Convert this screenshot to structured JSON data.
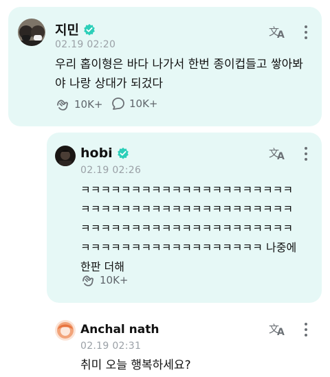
{
  "posts": [
    {
      "author": "지민",
      "time": "02.19 02:20",
      "text": "우리 홉이형은 바다 나가서 한번 종이컵들고 쌓아봐야 나랑 상대가 되겄다",
      "likes": "10K+",
      "comments": "10K+"
    },
    {
      "author": "hobi",
      "time": "02.19 02:26",
      "text": "ㅋㅋㅋㅋㅋㅋㅋㅋㅋㅋㅋㅋㅋㅋㅋㅋㅋㅋㅋㅋㅋㅋㅋㅋㅋㅋㅋㅋㅋㅋㅋㅋㅋㅋㅋㅋㅋㅋㅋㅋㅋㅋㅋㅋㅋㅋㅋㅋㅋㅋㅋㅋㅋㅋㅋㅋㅋㅋㅋㅋㅋㅋㅋㅋㅋㅋㅋㅋㅋㅋㅋㅋㅋㅋㅋㅋㅋㅋㅋㅋㅋ 나중에 한판 더해",
      "likes": "10K+"
    },
    {
      "author": "Anchal nath",
      "time": "02.19 02:31",
      "text": "취미 오늘 행복하세요?"
    }
  ],
  "icons": {
    "verified": "verified-badge-icon",
    "translate": "translate-icon",
    "more": "more-vertical-icon",
    "like": "like-hands-icon",
    "comment": "comment-bubble-icon"
  },
  "colors": {
    "card_bg": "#e6f8f6",
    "verified": "#2ccfb9",
    "meta_gray": "#9aa0a6"
  }
}
